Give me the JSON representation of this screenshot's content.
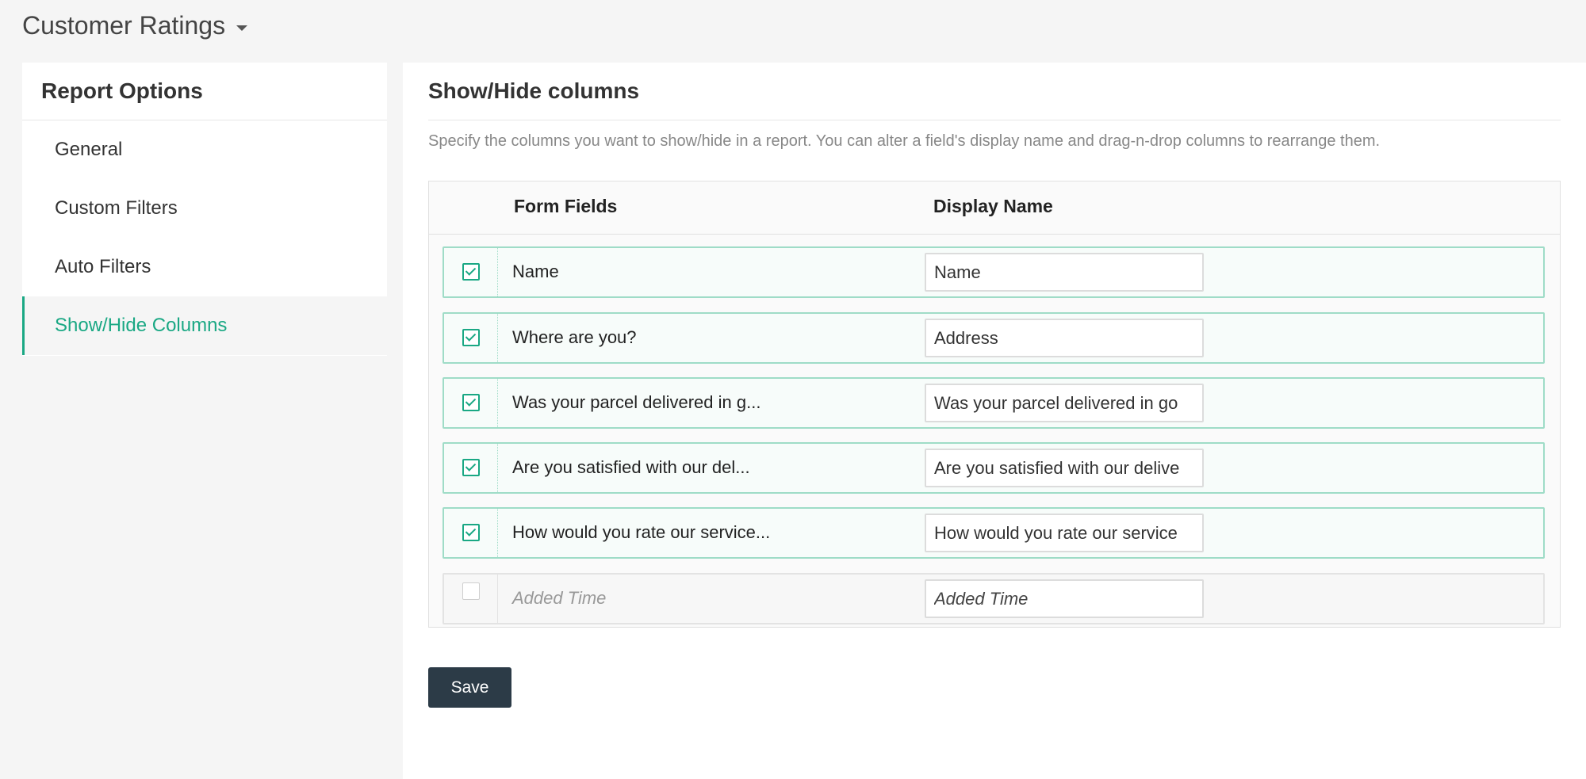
{
  "header": {
    "title": "Customer Ratings"
  },
  "sidebar": {
    "heading": "Report Options",
    "items": [
      {
        "label": "General",
        "active": false
      },
      {
        "label": "Custom Filters",
        "active": false
      },
      {
        "label": "Auto Filters",
        "active": false
      },
      {
        "label": "Show/Hide Columns",
        "active": true
      }
    ]
  },
  "main": {
    "title": "Show/Hide columns",
    "description": "Specify the columns you want to show/hide in a report. You can alter a field's display name and drag-n-drop columns to rearrange them.",
    "table": {
      "headers": {
        "form_fields": "Form Fields",
        "display_name": "Display Name"
      },
      "rows": [
        {
          "field": "Name",
          "display": "Name",
          "checked": true
        },
        {
          "field": "Where are you?",
          "display": "Address",
          "checked": true
        },
        {
          "field": "Was your parcel delivered in g...",
          "display": "Was your parcel delivered in go",
          "checked": true
        },
        {
          "field": "Are you satisfied with our del...",
          "display": "Are you satisfied with our delive",
          "checked": true
        },
        {
          "field": "How would you rate our service...",
          "display": "How would you rate our service",
          "checked": true
        },
        {
          "field": "Added Time",
          "display": "Added Time",
          "checked": false
        }
      ]
    },
    "save_label": "Save"
  },
  "colors": {
    "accent": "#1aa884",
    "button": "#2c3b47",
    "row_border": "#9fdcc7"
  }
}
